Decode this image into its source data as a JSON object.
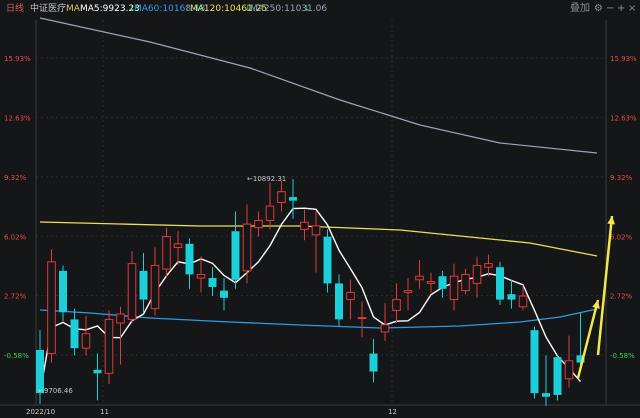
{
  "header": {
    "period_label": "日线",
    "index_name": "中证医疗",
    "ma_label": "MA",
    "ma5": "MA5:9923.23",
    "ma60": "MA60:10168.48",
    "ma120": "MA120:10461.25",
    "ma250": "MA250:11031.06",
    "ma5_arrow": "↓",
    "ma60_arrow": "↑",
    "ma120_arrow": "↓",
    "ma250_arrow": "↓",
    "toolbar": {
      "overlay_label": "叠加",
      "settings_icon": "gear-icon",
      "minus_icon": "minus-icon",
      "plus_icon": "plus-icon",
      "close_icon": "close-icon"
    }
  },
  "colors": {
    "up": "#e03a3a",
    "down": "#1ccfd8",
    "ma5": "#ffffff",
    "ma60": "#2e9be6",
    "ma120": "#e8e05a",
    "ma250": "#9aa6b8",
    "arrow": "#f2e84a",
    "green_label": "#38d05a",
    "red_label": "#e84a4a"
  },
  "chart_data": {
    "type": "candlestick",
    "y_axis_labels": [
      "15.93%",
      "12.63%",
      "9.32%",
      "6.02%",
      "2.72%",
      "-0.58%"
    ],
    "y_axis_values": [
      15.93,
      12.63,
      9.32,
      6.02,
      2.72,
      -0.58
    ],
    "x_axis_labels": [
      "2022/10",
      "11",
      "12"
    ],
    "annotations": {
      "high": "←10892.31",
      "low": "←9706.46"
    },
    "candles": [
      {
        "o": -0.3,
        "c": -2.7,
        "h": 0.8,
        "l": -3.3
      },
      {
        "o": -0.5,
        "c": 4.6,
        "h": 5.3,
        "l": -1.0
      },
      {
        "o": 4.1,
        "c": 1.8,
        "h": 4.4,
        "l": 1.3
      },
      {
        "o": 1.4,
        "c": -0.2,
        "h": 2.0,
        "l": -0.6
      },
      {
        "o": -0.2,
        "c": 0.6,
        "h": 1.6,
        "l": -0.6
      },
      {
        "o": -1.4,
        "c": -1.6,
        "h": -0.5,
        "l": -3.1
      },
      {
        "o": -1.6,
        "c": 1.4,
        "h": 1.9,
        "l": -2.2
      },
      {
        "o": 1.2,
        "c": 1.7,
        "h": 2.1,
        "l": -1.1
      },
      {
        "o": 1.4,
        "c": 4.5,
        "h": 5.2,
        "l": 1.2
      },
      {
        "o": 4.1,
        "c": 2.5,
        "h": 5.1,
        "l": 1.8
      },
      {
        "o": 2.0,
        "c": 4.4,
        "h": 5.4,
        "l": 1.6
      },
      {
        "o": 4.2,
        "c": 6.0,
        "h": 6.5,
        "l": 3.7
      },
      {
        "o": 5.4,
        "c": 5.6,
        "h": 6.3,
        "l": 4.4
      },
      {
        "o": 5.6,
        "c": 3.9,
        "h": 5.9,
        "l": 3.1
      },
      {
        "o": 3.7,
        "c": 3.9,
        "h": 4.9,
        "l": 2.9
      },
      {
        "o": 3.7,
        "c": 3.2,
        "h": 4.3,
        "l": 2.7
      },
      {
        "o": 3.0,
        "c": 2.6,
        "h": 3.7,
        "l": 1.9
      },
      {
        "o": 6.3,
        "c": 3.6,
        "h": 7.4,
        "l": 3.1
      },
      {
        "o": 4.1,
        "c": 6.7,
        "h": 7.8,
        "l": 3.4
      },
      {
        "o": 6.5,
        "c": 6.9,
        "h": 7.4,
        "l": 6.0
      },
      {
        "o": 6.9,
        "c": 7.7,
        "h": 9.0,
        "l": 6.4
      },
      {
        "o": 7.9,
        "c": 8.5,
        "h": 9.1,
        "l": 7.4
      },
      {
        "o": 8.2,
        "c": 8.0,
        "h": 9.2,
        "l": 7.0
      },
      {
        "o": 6.4,
        "c": 6.8,
        "h": 7.5,
        "l": 5.8
      },
      {
        "o": 6.1,
        "c": 6.6,
        "h": 7.4,
        "l": 4.0
      },
      {
        "o": 6.0,
        "c": 3.4,
        "h": 6.4,
        "l": 2.9
      },
      {
        "o": 3.4,
        "c": 1.4,
        "h": 3.9,
        "l": 1.0
      },
      {
        "o": 2.5,
        "c": 2.9,
        "h": 3.6,
        "l": 1.4
      },
      {
        "o": 1.5,
        "c": 1.5,
        "h": 2.4,
        "l": 0.4
      },
      {
        "o": -0.5,
        "c": -1.5,
        "h": 0.3,
        "l": -2.1
      },
      {
        "o": 0.7,
        "c": 1.1,
        "h": 2.3,
        "l": 0.2
      },
      {
        "o": 1.9,
        "c": 2.5,
        "h": 3.4,
        "l": 1.2
      },
      {
        "o": 2.9,
        "c": 3.0,
        "h": 3.7,
        "l": 1.9
      },
      {
        "o": 3.6,
        "c": 3.8,
        "h": 4.7,
        "l": 3.1
      },
      {
        "o": 3.4,
        "c": 3.5,
        "h": 4.0,
        "l": 2.9
      },
      {
        "o": 3.8,
        "c": 3.1,
        "h": 4.1,
        "l": 2.6
      },
      {
        "o": 2.5,
        "c": 3.8,
        "h": 4.5,
        "l": 1.9
      },
      {
        "o": 3.0,
        "c": 3.9,
        "h": 4.2,
        "l": 2.8
      },
      {
        "o": 3.4,
        "c": 4.4,
        "h": 4.9,
        "l": 2.6
      },
      {
        "o": 4.3,
        "c": 4.5,
        "h": 5.0,
        "l": 3.8
      },
      {
        "o": 4.3,
        "c": 2.5,
        "h": 4.6,
        "l": 2.2
      },
      {
        "o": 2.8,
        "c": 2.5,
        "h": 3.6,
        "l": 2.0
      },
      {
        "o": 2.1,
        "c": 2.7,
        "h": 3.3,
        "l": 1.9
      },
      {
        "o": 0.8,
        "c": -2.7,
        "h": 1.0,
        "l": -3.0
      },
      {
        "o": -2.7,
        "c": -2.9,
        "h": -0.6,
        "l": -3.4
      },
      {
        "o": -0.7,
        "c": -2.8,
        "h": -0.6,
        "l": -3.1
      },
      {
        "o": -1.9,
        "c": -0.9,
        "h": 0.5,
        "l": -2.4
      },
      {
        "o": -0.6,
        "c": -1.0,
        "h": 1.8,
        "l": -1.2
      }
    ]
  }
}
